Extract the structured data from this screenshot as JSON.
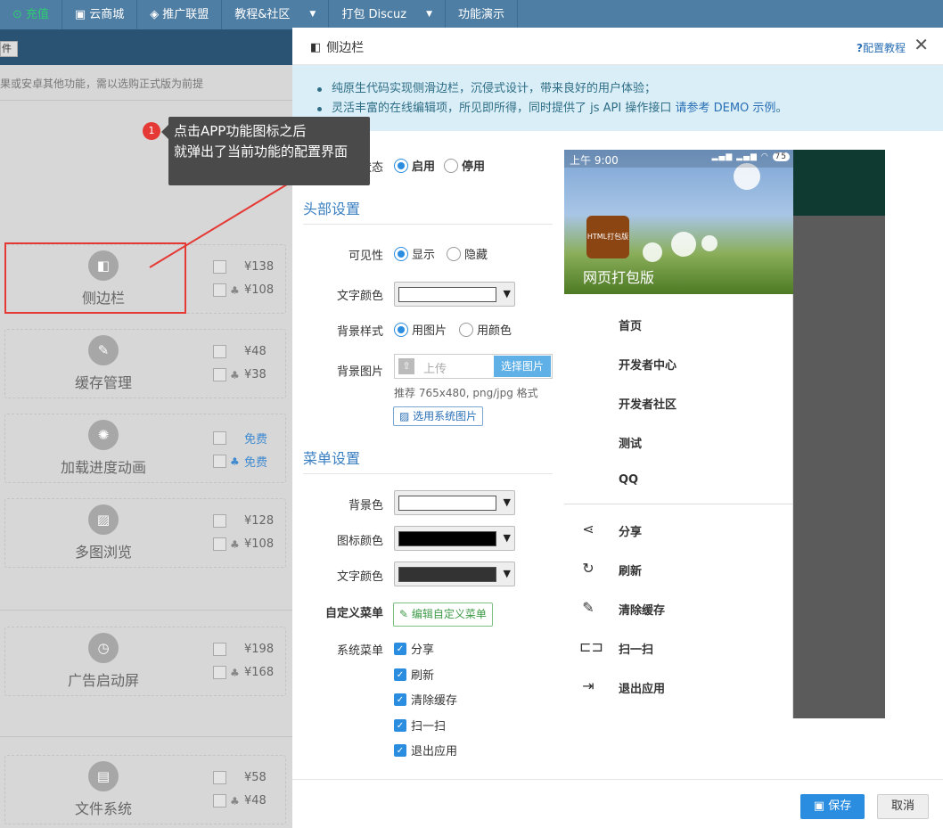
{
  "nav": {
    "recharge": "充值",
    "cloud_store": "云商城",
    "promo": "推广联盟",
    "tutorials": "教程&社区",
    "pack": "打包 Discuz",
    "demo": "功能演示"
  },
  "bg": {
    "button": "件",
    "notice": "果或安卓其他功能，需以选购正式版为前提",
    "cards": [
      {
        "name": "侧边栏",
        "ios": "¥138",
        "android": "¥108"
      },
      {
        "name": "缓存管理",
        "ios": "¥48",
        "android": "¥38"
      },
      {
        "name": "加载进度动画",
        "ios": "免费",
        "android": "免费"
      },
      {
        "name": "多图浏览",
        "ios": "¥128",
        "android": "¥108"
      },
      {
        "name": "广告启动屏",
        "ios": "¥198",
        "android": "¥168"
      },
      {
        "name": "文件系统",
        "ios": "¥58",
        "android": "¥48"
      }
    ]
  },
  "tooltip": {
    "badge": "1",
    "line1": "点击APP功能图标之后",
    "line2": "就弹出了当前功能的配置界面"
  },
  "modal": {
    "title": "侧边栏",
    "help": "配置教程",
    "info1": "纯原生代码实现侧滑边栏，沉侵式设计，带来良好的用户体验；",
    "info2_pre": "灵活丰富的在线编辑项，所见即所得，同时提供了 js API 操作接口 ",
    "info2_link": "请参考 DEMO 示例",
    "info2_post": "。",
    "status_label": "状态",
    "status_on": "启用",
    "status_off": "停用",
    "head_section": "头部设置",
    "visibility_label": "可见性",
    "vis_show": "显示",
    "vis_hide": "隐藏",
    "text_color_label": "文字颜色",
    "bg_style_label": "背景样式",
    "bg_img": "用图片",
    "bg_color": "用颜色",
    "bg_image_label": "背景图片",
    "upload_placeholder": "上传",
    "choose_image": "选择图片",
    "image_hint": "推荐 765x480, png/jpg 格式",
    "system_image": "选用系统图片",
    "menu_section": "菜单设置",
    "menu_bg_label": "背景色",
    "menu_icon_label": "图标颜色",
    "menu_text_label": "文字颜色",
    "custom_menu_label": "自定义菜单",
    "edit_custom_menu": "编辑自定义菜单",
    "system_menu_label": "系统菜单",
    "system_menu": [
      "分享",
      "刷新",
      "清除缓存",
      "扫一扫",
      "退出应用"
    ],
    "save": "保存",
    "cancel": "取消"
  },
  "colors": {
    "text_color": "#ffffff",
    "menu_bg": "#ffffff",
    "menu_icon": "#000000",
    "menu_text": "#333333"
  },
  "phone": {
    "time": "上午 9:00",
    "battery": "75",
    "logo_text": "HTML打包版",
    "app_name": "网页打包版",
    "menu": [
      "首页",
      "开发者中心",
      "开发者社区",
      "测试",
      "QQ"
    ],
    "actions": [
      "分享",
      "刷新",
      "清除缓存",
      "扫一扫",
      "退出应用"
    ]
  }
}
